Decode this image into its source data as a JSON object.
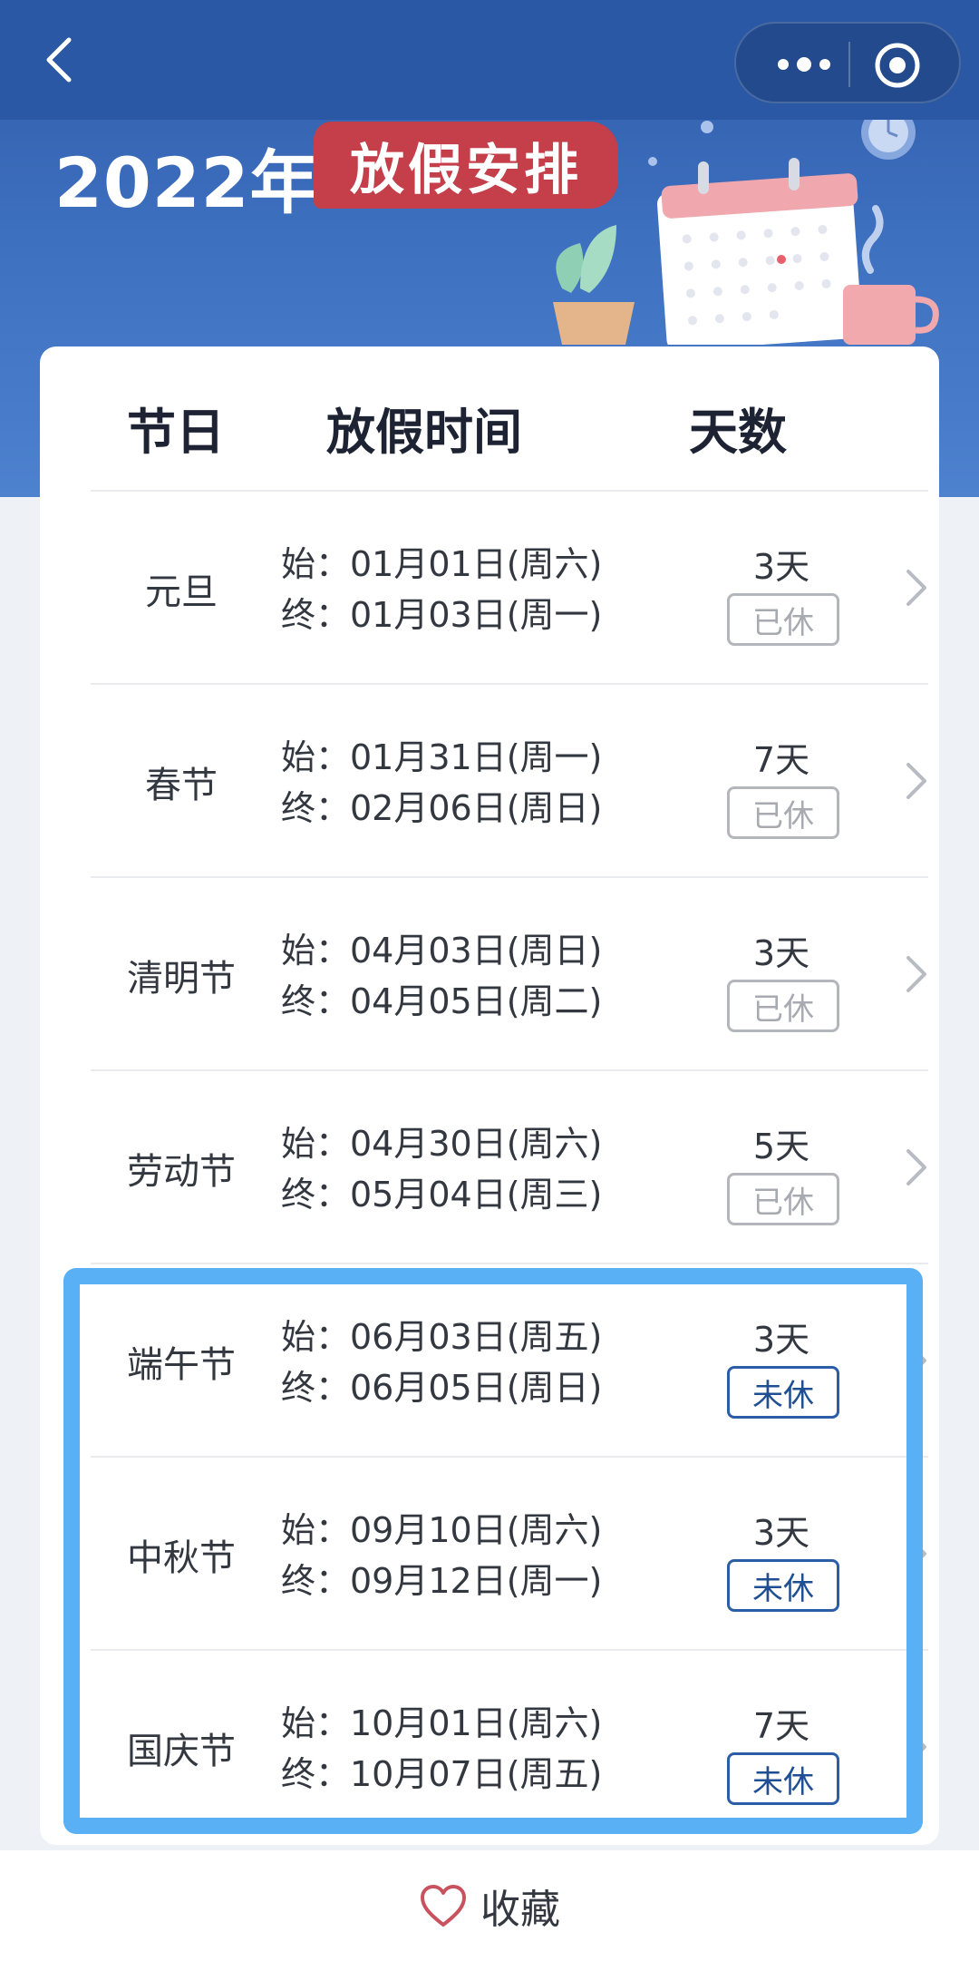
{
  "header": {
    "title_year": "2022年",
    "title_tag": "放假安排"
  },
  "table": {
    "columns": [
      "节日",
      "放假时间",
      "天数"
    ],
    "rows": [
      {
        "name": "元旦",
        "start": "始：01月01日(周六)",
        "end": "终：01月03日(周一)",
        "days": "3天",
        "status": "已休"
      },
      {
        "name": "春节",
        "start": "始：01月31日(周一)",
        "end": "终：02月06日(周日)",
        "days": "7天",
        "status": "已休"
      },
      {
        "name": "清明节",
        "start": "始：04月03日(周日)",
        "end": "终：04月05日(周二)",
        "days": "3天",
        "status": "已休"
      },
      {
        "name": "劳动节",
        "start": "始：04月30日(周六)",
        "end": "终：05月04日(周三)",
        "days": "5天",
        "status": "已休"
      },
      {
        "name": "端午节",
        "start": "始：06月03日(周五)",
        "end": "终：06月05日(周日)",
        "days": "3天",
        "status": "未休"
      },
      {
        "name": "中秋节",
        "start": "始：09月10日(周六)",
        "end": "终：09月12日(周一)",
        "days": "3天",
        "status": "未休"
      },
      {
        "name": "国庆节",
        "start": "始：10月01日(周六)",
        "end": "终：10月07日(周五)",
        "days": "7天",
        "status": "未休"
      }
    ]
  },
  "footer": {
    "favorite_label": "收藏"
  },
  "colors": {
    "header_blue": "#2a58a4",
    "tag_red": "#c43f4a",
    "highlight_blue": "#59b0f5",
    "badge_pending": "#2b5ea6",
    "badge_done": "#b3b6bb"
  }
}
